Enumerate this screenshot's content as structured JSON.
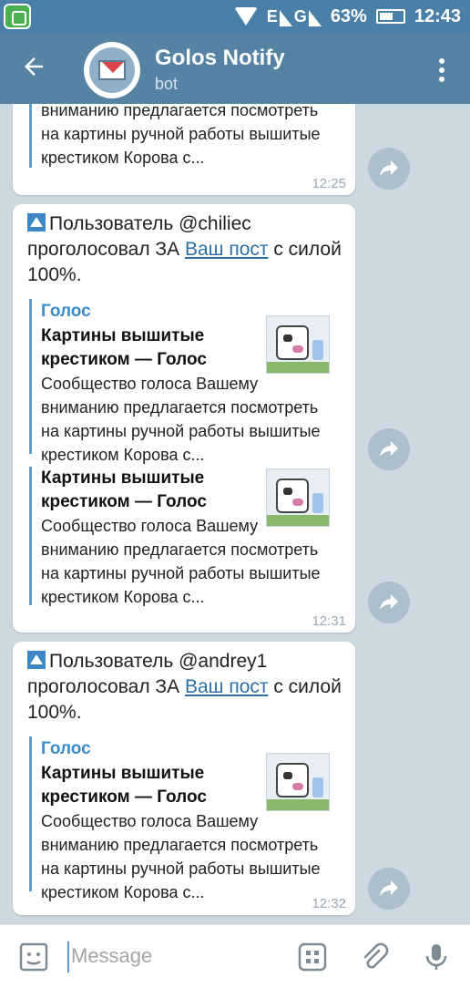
{
  "status_bar": {
    "network": "E",
    "signal_label": "G",
    "battery_percent": "63%",
    "time": "12:43"
  },
  "header": {
    "title": "Golos Notify",
    "subtitle": "bot"
  },
  "messages": [
    {
      "partial_desc": "вниманию предлагается посмотреть на картины ручной работы вышитые крестиком  Корова с...",
      "time": "12:25"
    },
    {
      "prefix": "Пользователь @chiliec проголосовал ЗА ",
      "link": "Ваш пост",
      "suffix": " с силой 100%.",
      "previews": [
        {
          "site": "Голос",
          "title": "Картины вышитые крестиком — Голос",
          "desc": "Сообщество голоса Вашему вниманию предлагается посмотреть на картины ручной работы вышитые крестиком  Корова с..."
        },
        {
          "title": "Картины вышитые крестиком — Голос",
          "desc": "Сообщество голоса Вашему вниманию предлагается посмотреть на картины ручной работы вышитые крестиком  Корова с..."
        }
      ],
      "time": "12:31"
    },
    {
      "prefix": "Пользователь @andrey1 проголосовал ЗА ",
      "link": "Ваш пост",
      "suffix": " с силой 100%.",
      "previews": [
        {
          "site": "Голос",
          "title": "Картины вышитые крестиком — Голос",
          "desc": "Сообщество голоса Вашему вниманию предлагается посмотреть на картины ручной работы вышитые крестиком  Корова с..."
        }
      ],
      "time": "12:32"
    }
  ],
  "input": {
    "placeholder": "Message"
  },
  "icons": [
    "back-arrow-icon",
    "menu-icon",
    "share-icon",
    "emoji-icon",
    "sticker-icon",
    "attach-icon",
    "mic-icon"
  ]
}
